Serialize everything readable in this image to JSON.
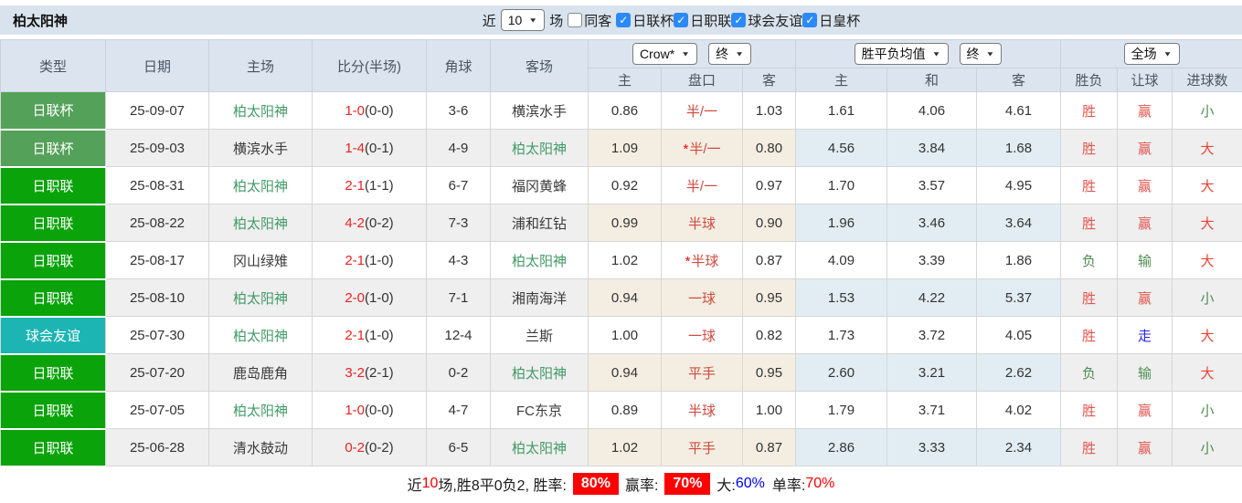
{
  "colors": {
    "accent_checkbox": "#2b8af7",
    "league_cup": "#54a159",
    "league_j1": "#0aa30a",
    "friendly": "#1db4b4",
    "rate_box_bg": "#ff0000"
  },
  "toolbar": {
    "title": "柏太阳神",
    "recent_label": "近",
    "recent_select": "10",
    "games_label": "场",
    "same_venue": {
      "label": "同客",
      "checked": false
    },
    "filters": [
      {
        "label": "日联杯",
        "checked": true
      },
      {
        "label": "日职联",
        "checked": true
      },
      {
        "label": "球会友谊",
        "checked": true
      },
      {
        "label": "日皇杯",
        "checked": true
      }
    ]
  },
  "table": {
    "columns": [
      "类型",
      "日期",
      "主场",
      "比分(半场)",
      "角球",
      "客场"
    ],
    "asia_company_select": "Crow*",
    "asia_stage_select": "终",
    "euro_company_select": "胜平负均值",
    "euro_stage_select": "终",
    "scope_select": "全场",
    "asia_sub_columns": [
      "主",
      "盘口",
      "客"
    ],
    "euro_sub_columns": [
      "主",
      "和",
      "客"
    ],
    "result_sub_columns": [
      "胜负",
      "让球",
      "进球数"
    ],
    "rows": [
      {
        "type": "日联杯",
        "type_color": "#54a159",
        "date": "25-09-07",
        "home": "柏太阳神",
        "home_self": true,
        "score": "1-0",
        "half": "(0-0)",
        "corners": "3-6",
        "away": "横滨水手",
        "away_self": false,
        "asia": {
          "home": "0.86",
          "line": "半/一",
          "star": false,
          "away": "1.03"
        },
        "euro": {
          "home": "1.61",
          "draw": "4.06",
          "away": "4.61"
        },
        "result": {
          "wdl": "胜",
          "wdl_class": "t-red",
          "let": "赢",
          "let_class": "t-red",
          "goal": "小",
          "goal_class": "t-green"
        }
      },
      {
        "type": "日联杯",
        "type_color": "#54a159",
        "date": "25-09-03",
        "home": "横滨水手",
        "home_self": false,
        "score": "1-4",
        "half": "(0-1)",
        "corners": "4-9",
        "away": "柏太阳神",
        "away_self": true,
        "asia": {
          "home": "1.09",
          "line": "半/一",
          "star": true,
          "away": "0.80"
        },
        "euro": {
          "home": "4.56",
          "draw": "3.84",
          "away": "1.68"
        },
        "result": {
          "wdl": "胜",
          "wdl_class": "t-red",
          "let": "赢",
          "let_class": "t-red",
          "goal": "大",
          "goal_class": "t-bigred"
        }
      },
      {
        "type": "日职联",
        "type_color": "#0aa30a",
        "date": "25-08-31",
        "home": "柏太阳神",
        "home_self": true,
        "score": "2-1",
        "half": "(1-1)",
        "corners": "6-7",
        "away": "福冈黄蜂",
        "away_self": false,
        "asia": {
          "home": "0.92",
          "line": "半/一",
          "star": false,
          "away": "0.97"
        },
        "euro": {
          "home": "1.70",
          "draw": "3.57",
          "away": "4.95"
        },
        "result": {
          "wdl": "胜",
          "wdl_class": "t-red",
          "let": "赢",
          "let_class": "t-red",
          "goal": "大",
          "goal_class": "t-bigred"
        }
      },
      {
        "type": "日职联",
        "type_color": "#0aa30a",
        "date": "25-08-22",
        "home": "柏太阳神",
        "home_self": true,
        "score": "4-2",
        "half": "(0-2)",
        "corners": "7-3",
        "away": "浦和红钻",
        "away_self": false,
        "asia": {
          "home": "0.99",
          "line": "半球",
          "star": false,
          "away": "0.90"
        },
        "euro": {
          "home": "1.96",
          "draw": "3.46",
          "away": "3.64"
        },
        "result": {
          "wdl": "胜",
          "wdl_class": "t-red",
          "let": "赢",
          "let_class": "t-red",
          "goal": "大",
          "goal_class": "t-bigred"
        }
      },
      {
        "type": "日职联",
        "type_color": "#0aa30a",
        "date": "25-08-17",
        "home": "冈山绿雉",
        "home_self": false,
        "score": "2-1",
        "half": "(1-0)",
        "corners": "4-3",
        "away": "柏太阳神",
        "away_self": true,
        "asia": {
          "home": "1.02",
          "line": "半球",
          "star": true,
          "away": "0.87"
        },
        "euro": {
          "home": "4.09",
          "draw": "3.39",
          "away": "1.86"
        },
        "result": {
          "wdl": "负",
          "wdl_class": "t-green",
          "let": "输",
          "let_class": "t-green",
          "goal": "大",
          "goal_class": "t-bigred"
        }
      },
      {
        "type": "日职联",
        "type_color": "#0aa30a",
        "date": "25-08-10",
        "home": "柏太阳神",
        "home_self": true,
        "score": "2-0",
        "half": "(1-0)",
        "corners": "7-1",
        "away": "湘南海洋",
        "away_self": false,
        "asia": {
          "home": "0.94",
          "line": "一球",
          "star": false,
          "away": "0.95"
        },
        "euro": {
          "home": "1.53",
          "draw": "4.22",
          "away": "5.37"
        },
        "result": {
          "wdl": "胜",
          "wdl_class": "t-red",
          "let": "赢",
          "let_class": "t-red",
          "goal": "小",
          "goal_class": "t-green"
        }
      },
      {
        "type": "球会友谊",
        "type_color": "#1db4b4",
        "date": "25-07-30",
        "home": "柏太阳神",
        "home_self": true,
        "score": "2-1",
        "half": "(1-0)",
        "corners": "12-4",
        "away": "兰斯",
        "away_self": false,
        "asia": {
          "home": "1.00",
          "line": "一球",
          "star": false,
          "away": "0.82"
        },
        "euro": {
          "home": "1.73",
          "draw": "3.72",
          "away": "4.05"
        },
        "result": {
          "wdl": "胜",
          "wdl_class": "t-red",
          "let": "走",
          "let_class": "t-blue",
          "goal": "大",
          "goal_class": "t-bigred"
        }
      },
      {
        "type": "日职联",
        "type_color": "#0aa30a",
        "date": "25-07-20",
        "home": "鹿岛鹿角",
        "home_self": false,
        "score": "3-2",
        "half": "(2-1)",
        "corners": "0-2",
        "away": "柏太阳神",
        "away_self": true,
        "asia": {
          "home": "0.94",
          "line": "平手",
          "star": false,
          "away": "0.95"
        },
        "euro": {
          "home": "2.60",
          "draw": "3.21",
          "away": "2.62"
        },
        "result": {
          "wdl": "负",
          "wdl_class": "t-green",
          "let": "输",
          "let_class": "t-green",
          "goal": "大",
          "goal_class": "t-bigred"
        }
      },
      {
        "type": "日职联",
        "type_color": "#0aa30a",
        "date": "25-07-05",
        "home": "柏太阳神",
        "home_self": true,
        "score": "1-0",
        "half": "(0-0)",
        "corners": "4-7",
        "away": "FC东京",
        "away_self": false,
        "asia": {
          "home": "0.89",
          "line": "半球",
          "star": false,
          "away": "1.00"
        },
        "euro": {
          "home": "1.79",
          "draw": "3.71",
          "away": "4.02"
        },
        "result": {
          "wdl": "胜",
          "wdl_class": "t-red",
          "let": "赢",
          "let_class": "t-red",
          "goal": "小",
          "goal_class": "t-green"
        }
      },
      {
        "type": "日职联",
        "type_color": "#0aa30a",
        "date": "25-06-28",
        "home": "清水鼓动",
        "home_self": false,
        "score": "0-2",
        "half": "(0-2)",
        "corners": "6-5",
        "away": "柏太阳神",
        "away_self": true,
        "asia": {
          "home": "1.02",
          "line": "平手",
          "star": false,
          "away": "0.87"
        },
        "euro": {
          "home": "2.86",
          "draw": "3.33",
          "away": "2.34"
        },
        "result": {
          "wdl": "胜",
          "wdl_class": "t-red",
          "let": "赢",
          "let_class": "t-red",
          "goal": "小",
          "goal_class": "t-green"
        }
      }
    ]
  },
  "footer": {
    "near_label": "近",
    "count": "10",
    "summary": "场,胜8平0负2, 胜率:",
    "win_rate": "80%",
    "handicap_label": "赢率:",
    "handicap_rate": "70%",
    "big_label": "大:",
    "big_rate": "60%",
    "single_label": "单率:",
    "single_rate": "70%"
  }
}
